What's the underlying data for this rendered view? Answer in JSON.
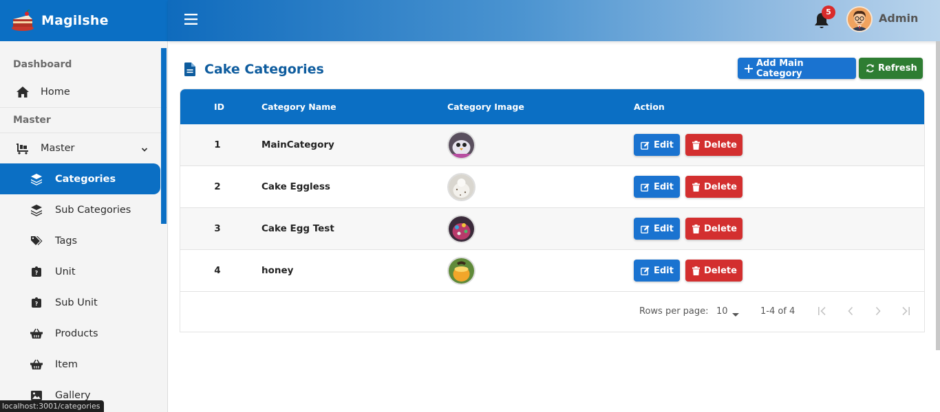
{
  "brand": {
    "name": "Magilshe"
  },
  "sidebar": {
    "sections": [
      {
        "title": "Dashboard"
      },
      {
        "title": "Master"
      }
    ],
    "home": {
      "label": "Home"
    },
    "master": {
      "label": "Master"
    },
    "items": [
      {
        "label": "Categories",
        "icon": "layers-icon",
        "active": true
      },
      {
        "label": "Sub Categories",
        "icon": "layers-icon"
      },
      {
        "label": "Tags",
        "icon": "tags-icon"
      },
      {
        "label": "Unit",
        "icon": "unit-icon"
      },
      {
        "label": "Sub Unit",
        "icon": "unit-icon"
      },
      {
        "label": "Products",
        "icon": "basket-icon"
      },
      {
        "label": "Item",
        "icon": "basket-icon"
      },
      {
        "label": "Gallery",
        "icon": "image-icon"
      }
    ]
  },
  "topbar": {
    "notification_count": "5",
    "user_name": "Admin"
  },
  "page": {
    "title": "Cake Categories",
    "add_button": "Add Main Category",
    "refresh_button": "Refresh"
  },
  "table": {
    "columns": [
      "ID",
      "Category Name",
      "Category Image",
      "Action"
    ],
    "rows": [
      {
        "id": "1",
        "name": "MainCategory"
      },
      {
        "id": "2",
        "name": "Cake Eggless"
      },
      {
        "id": "3",
        "name": "Cake Egg Test"
      },
      {
        "id": "4",
        "name": "honey"
      }
    ],
    "edit_label": "Edit",
    "delete_label": "Delete"
  },
  "pagination": {
    "rows_per_page_label": "Rows per page:",
    "rows_per_page_value": "10",
    "range": "1-4 of 4"
  },
  "status_url": "localhost:3001/categories",
  "colors": {
    "primary": "#0b6fc4",
    "success": "#2e7d32",
    "danger": "#d32f2f",
    "title": "#0e5c9e"
  }
}
